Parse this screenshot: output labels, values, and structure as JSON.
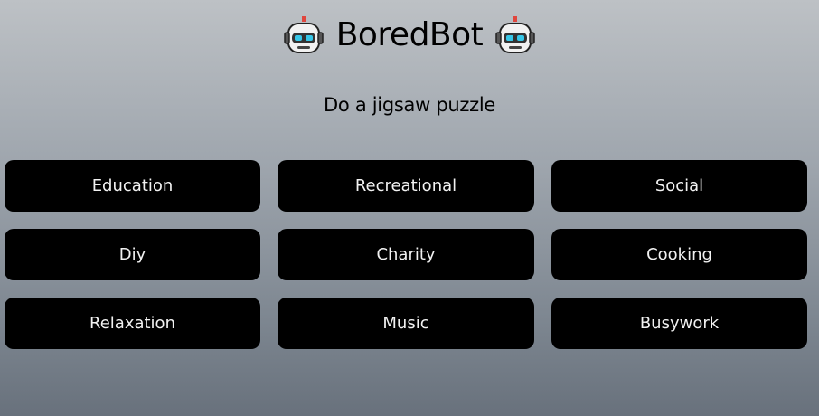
{
  "header": {
    "title": "BoredBot",
    "left_icon": "robot-face-icon",
    "right_icon": "robot-face-icon"
  },
  "suggestion": {
    "text": "Do a jigsaw puzzle"
  },
  "categories": [
    {
      "label": "Education"
    },
    {
      "label": "Recreational"
    },
    {
      "label": "Social"
    },
    {
      "label": "Diy"
    },
    {
      "label": "Charity"
    },
    {
      "label": "Cooking"
    },
    {
      "label": "Relaxation"
    },
    {
      "label": "Music"
    },
    {
      "label": "Busywork"
    }
  ],
  "colors": {
    "button_background": "#000000",
    "button_text": "#f2f2f2",
    "background_top": "#bdc1c5",
    "background_bottom": "#68717c"
  }
}
